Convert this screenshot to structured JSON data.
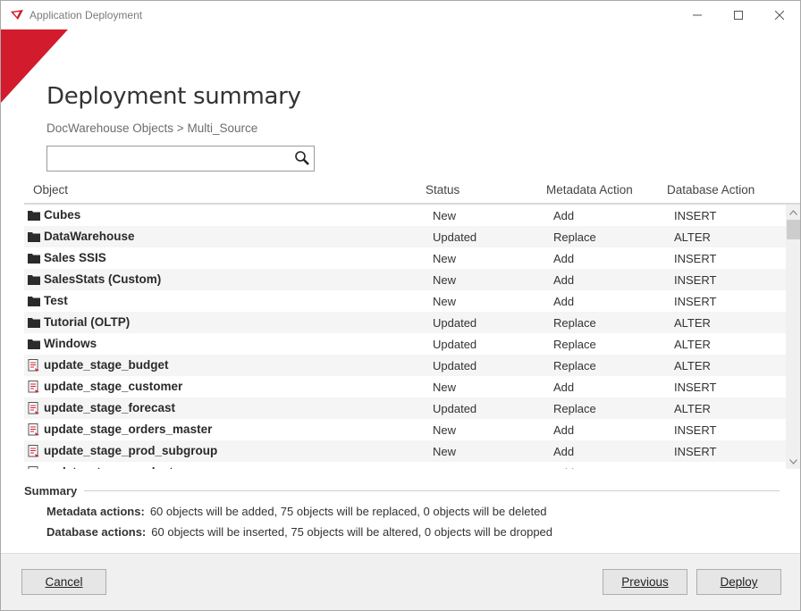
{
  "window": {
    "title": "Application Deployment"
  },
  "page": {
    "title": "Deployment summary",
    "breadcrumb": "DocWarehouse Objects > Multi_Source"
  },
  "search": {
    "placeholder": "",
    "value": ""
  },
  "grid": {
    "columns": {
      "object": "Object",
      "status": "Status",
      "metadata_action": "Metadata Action",
      "database_action": "Database Action"
    },
    "rows": [
      {
        "icon": "folder-icon",
        "name": "Cubes",
        "status": "New",
        "metadata": "Add",
        "database": "INSERT"
      },
      {
        "icon": "folder-icon",
        "name": "DataWarehouse",
        "status": "Updated",
        "metadata": "Replace",
        "database": "ALTER"
      },
      {
        "icon": "folder-icon",
        "name": "Sales SSIS",
        "status": "New",
        "metadata": "Add",
        "database": "INSERT"
      },
      {
        "icon": "folder-icon",
        "name": "SalesStats (Custom)",
        "status": "New",
        "metadata": "Add",
        "database": "INSERT"
      },
      {
        "icon": "folder-icon",
        "name": "Test",
        "status": "New",
        "metadata": "Add",
        "database": "INSERT"
      },
      {
        "icon": "folder-icon",
        "name": "Tutorial (OLTP)",
        "status": "Updated",
        "metadata": "Replace",
        "database": "ALTER"
      },
      {
        "icon": "folder-icon",
        "name": "Windows",
        "status": "Updated",
        "metadata": "Replace",
        "database": "ALTER"
      },
      {
        "icon": "script-icon",
        "name": "update_stage_budget",
        "status": "Updated",
        "metadata": "Replace",
        "database": "ALTER"
      },
      {
        "icon": "script-icon",
        "name": "update_stage_customer",
        "status": "New",
        "metadata": "Add",
        "database": "INSERT"
      },
      {
        "icon": "script-icon",
        "name": "update_stage_forecast",
        "status": "Updated",
        "metadata": "Replace",
        "database": "ALTER"
      },
      {
        "icon": "script-icon",
        "name": "update_stage_orders_master",
        "status": "New",
        "metadata": "Add",
        "database": "INSERT"
      },
      {
        "icon": "script-icon",
        "name": "update_stage_prod_subgroup",
        "status": "New",
        "metadata": "Add",
        "database": "INSERT"
      },
      {
        "icon": "script-icon",
        "name": "update_stage_product",
        "status": "New",
        "metadata": "Add",
        "database": "INSERT"
      }
    ]
  },
  "summary": {
    "title": "Summary",
    "metadata_label": "Metadata actions:",
    "metadata_text": "60 objects will be added,  75 objects will be replaced,  0 objects will be deleted",
    "database_label": "Database actions:",
    "database_text": "60 objects will be inserted,  75 objects will be altered,  0 objects will be dropped"
  },
  "buttons": {
    "cancel": "Cancel",
    "previous": "Previous",
    "deploy": "Deploy"
  },
  "colors": {
    "accent": "#d21b2c",
    "footer": "#f0f0f0"
  }
}
